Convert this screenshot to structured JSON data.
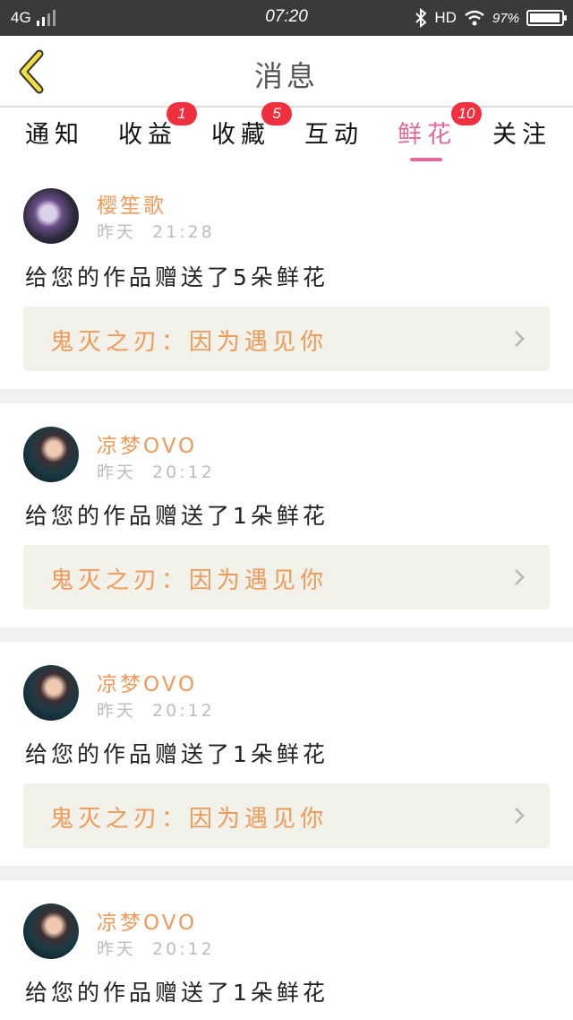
{
  "status_bar": {
    "network": "4G",
    "time": "07:20",
    "hd": "HD",
    "battery_percent": "97%",
    "battery_level": 0.97
  },
  "header": {
    "title": "消息"
  },
  "tabs": [
    {
      "label": "通知",
      "badge": ""
    },
    {
      "label": "收益",
      "badge": "1"
    },
    {
      "label": "收藏",
      "badge": "5"
    },
    {
      "label": "互动",
      "badge": ""
    },
    {
      "label": "鲜花",
      "badge": "10",
      "active": true
    },
    {
      "label": "关注",
      "badge": ""
    }
  ],
  "messages": [
    {
      "user": "樱笙歌",
      "date": "昨天",
      "time": "21:28",
      "text": "给您的作品赠送了5朵鲜花",
      "work": "鬼灭之刃：因为遇见你"
    },
    {
      "user": "凉梦OVO",
      "date": "昨天",
      "time": "20:12",
      "text": "给您的作品赠送了1朵鲜花",
      "work": "鬼灭之刃：因为遇见你"
    },
    {
      "user": "凉梦OVO",
      "date": "昨天",
      "time": "20:12",
      "text": "给您的作品赠送了1朵鲜花",
      "work": "鬼灭之刃：因为遇见你"
    },
    {
      "user": "凉梦OVO",
      "date": "昨天",
      "time": "20:12",
      "text": "给您的作品赠送了1朵鲜花",
      "work": ""
    }
  ],
  "colors": {
    "accent": "#e46a9c",
    "username": "#ef9a5a",
    "badge": "#f0303f",
    "work_bg": "#f2f1ea"
  }
}
